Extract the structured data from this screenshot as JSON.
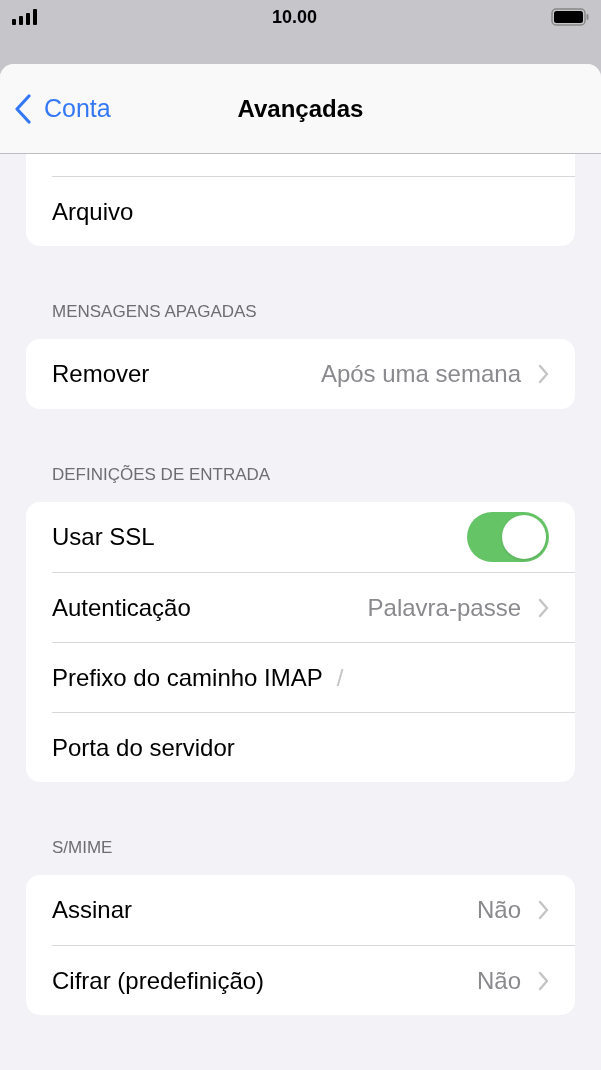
{
  "status_bar": {
    "time": "10.00"
  },
  "nav": {
    "back": "Conta",
    "title": "Avançadas"
  },
  "sections": [
    {
      "cut_top": true,
      "rows": [
        {
          "kind": "plain",
          "label": "Arquivo"
        }
      ]
    },
    {
      "header": "MENSAGENS APAGADAS",
      "rows": [
        {
          "kind": "value",
          "label": "Remover",
          "value": "Após uma semana"
        }
      ]
    },
    {
      "header": "DEFINIÇÕES DE ENTRADA",
      "rows": [
        {
          "kind": "toggle",
          "label": "Usar SSL",
          "on": true
        },
        {
          "kind": "value",
          "label": "Autenticação",
          "value": "Palavra-passe"
        },
        {
          "kind": "field",
          "label": "Prefixo do caminho IMAP",
          "value": "/"
        },
        {
          "kind": "plain",
          "label": "Porta do servidor"
        }
      ]
    },
    {
      "header": "S/MIME",
      "rows": [
        {
          "kind": "value",
          "label": "Assinar",
          "value": "Não"
        },
        {
          "kind": "value",
          "label": "Cifrar (predefinição)",
          "value": "Não"
        }
      ]
    }
  ]
}
